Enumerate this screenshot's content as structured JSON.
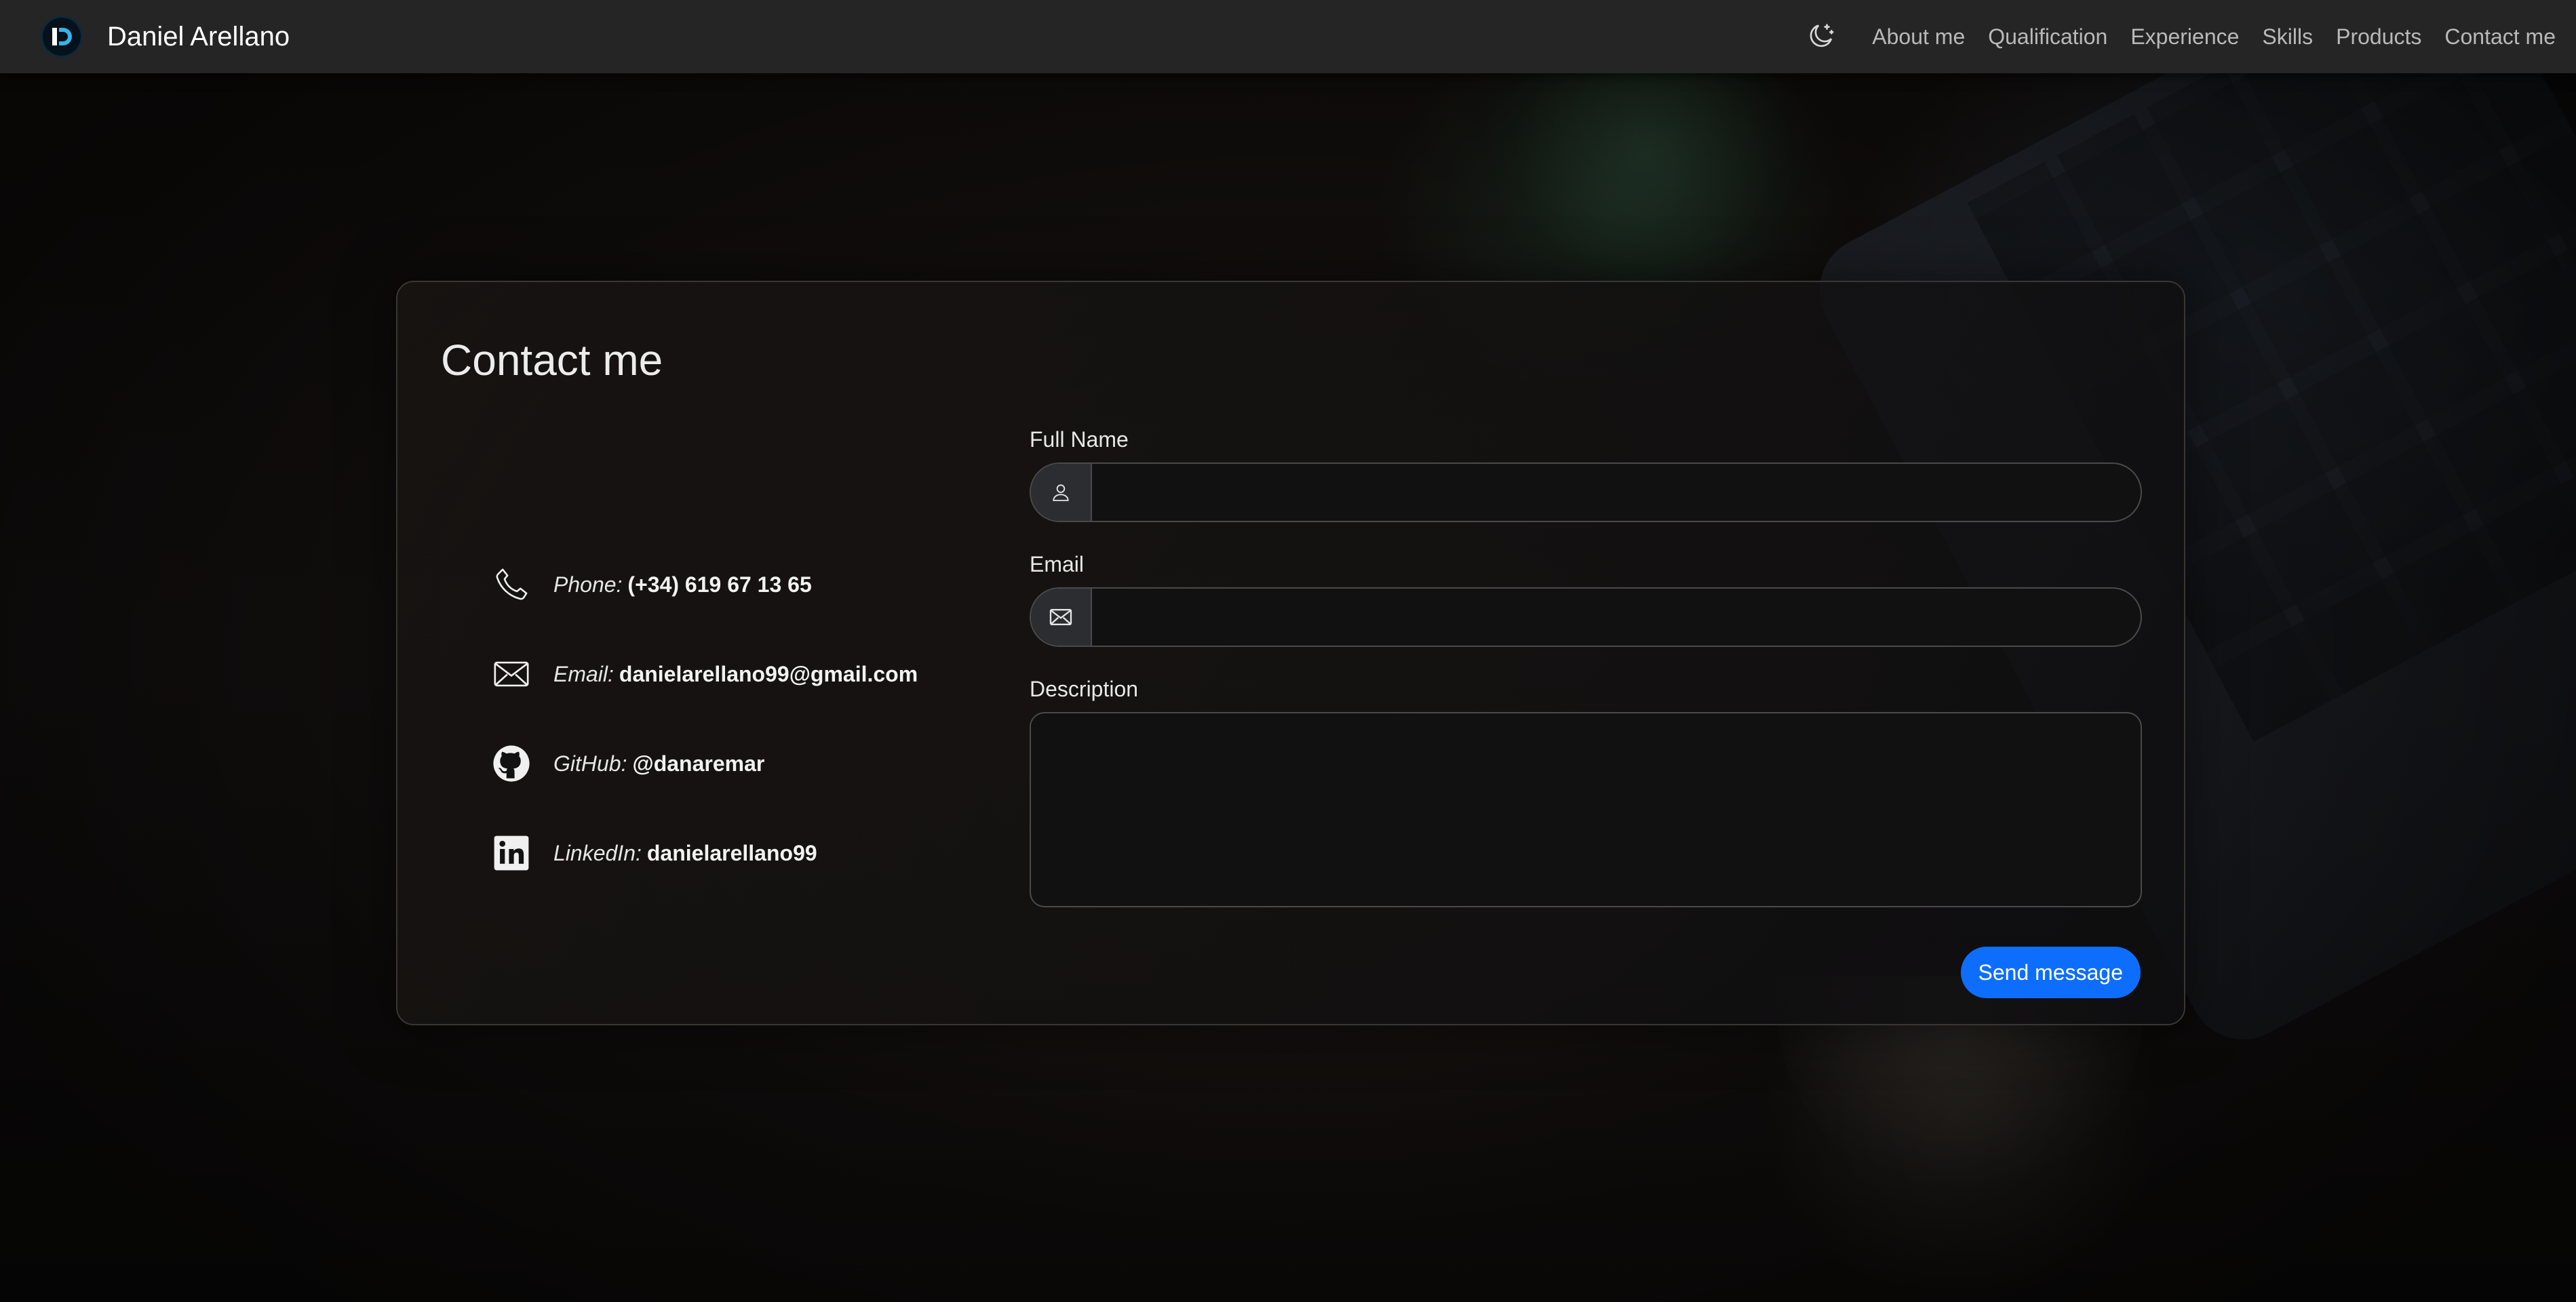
{
  "nav": {
    "brand_name": "Daniel Arellano",
    "links": [
      "About me",
      "Qualification",
      "Experience",
      "Skills",
      "Products",
      "Contact me"
    ],
    "theme_toggle_icon": "moon-stars-icon"
  },
  "contact": {
    "title": "Contact me",
    "items": [
      {
        "icon": "phone-icon",
        "key": "Phone:",
        "value": "(+34) 619 67 13 65"
      },
      {
        "icon": "envelope-icon",
        "key": "Email:",
        "value": "danielarellano99@gmail.com"
      },
      {
        "icon": "github-icon",
        "key": "GitHub:",
        "value": "@danaremar"
      },
      {
        "icon": "linkedin-icon",
        "key": "LinkedIn:",
        "value": "danielarellano99"
      }
    ],
    "form": {
      "full_name_label": "Full Name",
      "full_name_value": "",
      "email_label": "Email",
      "email_value": "",
      "description_label": "Description",
      "description_value": "",
      "send_label": "Send message"
    }
  },
  "colors": {
    "navbar_bg": "#252525",
    "primary_button": "#0d6efd",
    "card_border": "#3a3634"
  }
}
